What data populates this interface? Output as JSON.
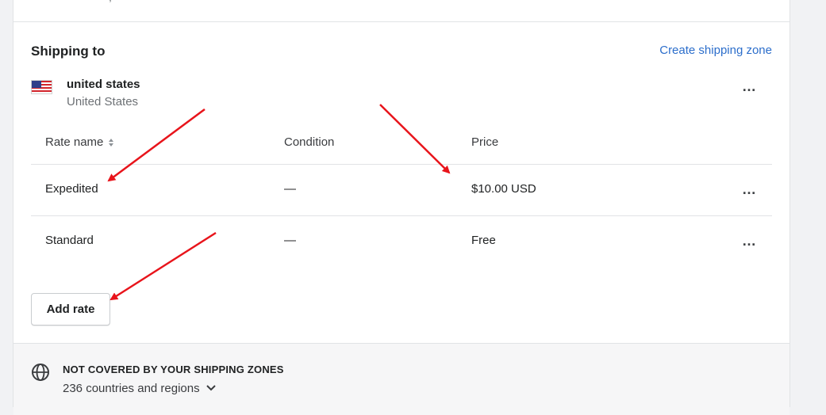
{
  "top": {
    "cut_text": ", "
  },
  "shipping": {
    "title": "Shipping to",
    "create_zone_label": "Create shipping zone",
    "zone": {
      "name": "united states",
      "country": "United States",
      "flag_icon": "us-flag-icon"
    },
    "table": {
      "headers": [
        "Rate name",
        "Condition",
        "Price"
      ],
      "rows": [
        {
          "name": "Expedited",
          "condition": "—",
          "price": "$10.00 USD"
        },
        {
          "name": "Standard",
          "condition": "—",
          "price": "Free"
        }
      ]
    },
    "add_rate_label": "Add rate",
    "more_icon": "…"
  },
  "not_covered": {
    "title": "NOT COVERED BY YOUR SHIPPING ZONES",
    "subtitle": "236 countries and regions",
    "icon": "globe-icon"
  },
  "colors": {
    "link": "#2c6ecb",
    "annotation_arrow": "#e8141b"
  }
}
